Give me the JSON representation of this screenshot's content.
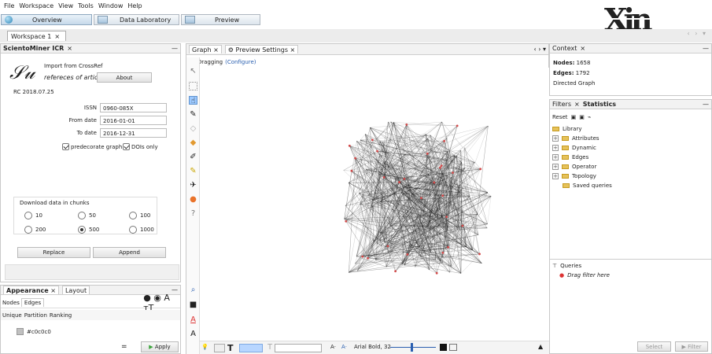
{
  "menu": [
    "File",
    "Workspace",
    "View",
    "Tools",
    "Window",
    "Help"
  ],
  "toolbar": {
    "overview": "Overview",
    "datalab": "Data Laboratory",
    "preview": "Preview"
  },
  "workspace_tab": "Workspace 1",
  "left_panel": {
    "title": "ScientoMiner ICR",
    "import_line1": "Import from CrossRef",
    "import_line2": "refereces of articles",
    "about": "About",
    "version": "RC 2018.07.25",
    "issn_label": "ISSN",
    "issn_value": "0960-085X",
    "from_label": "From date",
    "from_value": "2016-01-01",
    "to_label": "To date",
    "to_value": "2016-12-31",
    "predecorate": "predecorate graph",
    "dois": "DOIs only",
    "chunks_label": "Download data in chunks",
    "chunks": [
      "10",
      "50",
      "100",
      "200",
      "500",
      "1000"
    ],
    "selected_chunk": "500",
    "replace": "Replace",
    "append": "Append"
  },
  "appearance": {
    "tab1": "Appearance",
    "tab2": "Layout",
    "nodes": "Nodes",
    "edges": "Edges",
    "unique": "Unique",
    "partition": "Partition",
    "ranking": "Ranking",
    "color": "#c0c0c0",
    "apply": "Apply"
  },
  "graph": {
    "tab1": "Graph",
    "tab2": "Preview Settings",
    "dragging": "Dragging",
    "configure": "(Configure)",
    "font": "Arial Bold, 32"
  },
  "context": {
    "title": "Context",
    "nodes_label": "Nodes:",
    "nodes_value": "1658",
    "edges_label": "Edges:",
    "edges_value": "1792",
    "type": "Directed Graph"
  },
  "filters": {
    "tab1": "Filters",
    "tab2": "Statistics",
    "reset": "Reset",
    "library": "Library",
    "items": [
      "Attributes",
      "Dynamic",
      "Edges",
      "Operator",
      "Topology",
      "Saved queries"
    ],
    "queries": "Queries",
    "drag": "Drag filter here",
    "select": "Select",
    "filter": "Filter"
  },
  "icons": [
    "overview-icon",
    "data-laboratory-icon",
    "preview-icon",
    "workspace-close-icon",
    "graph-tools"
  ]
}
